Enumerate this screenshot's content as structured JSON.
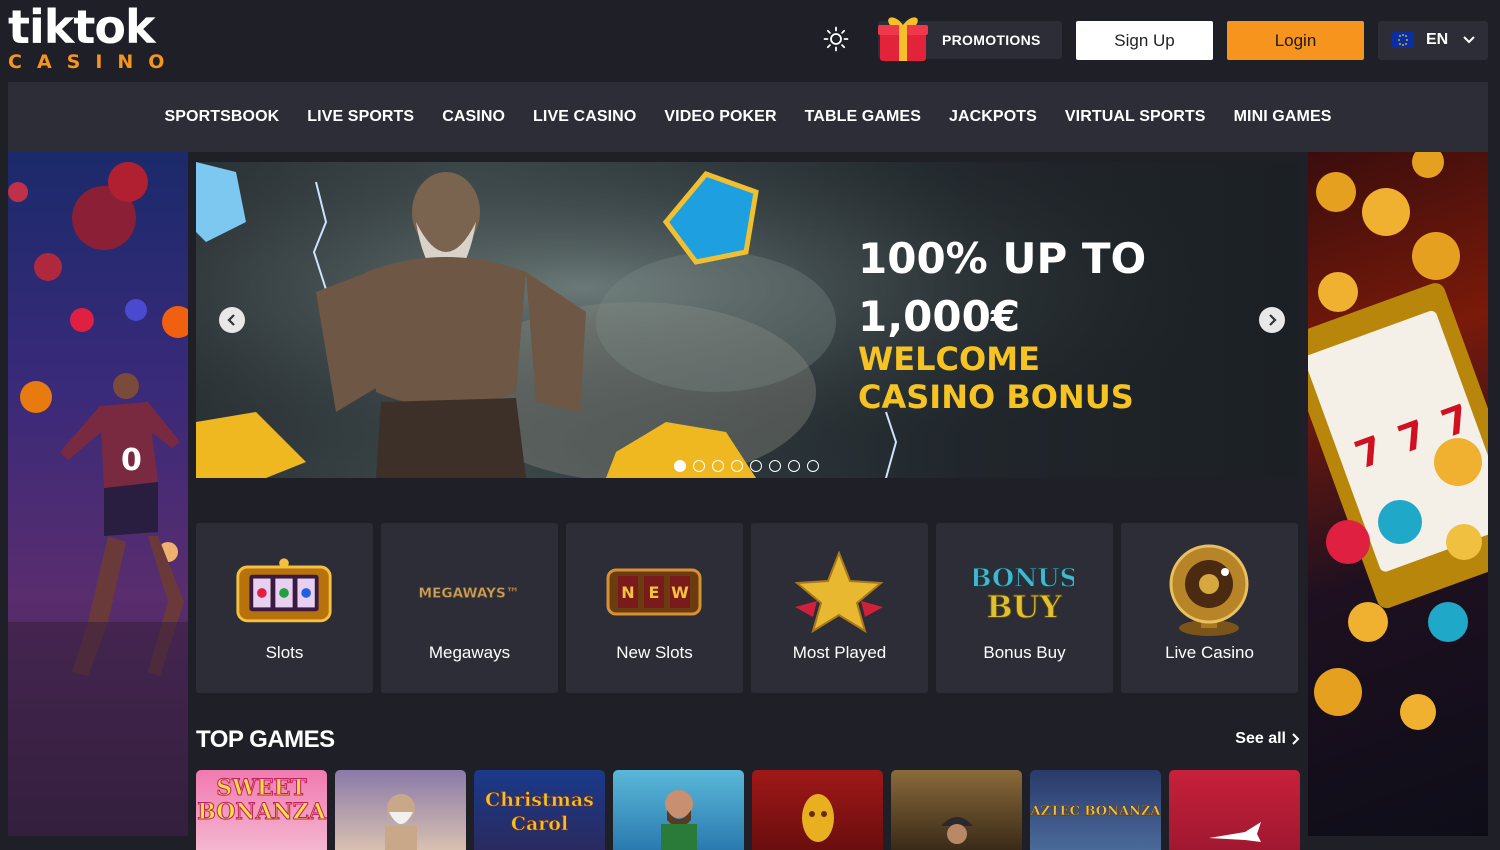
{
  "header": {
    "logo_word": "tiktok",
    "logo_sub": "CASINO",
    "promotions_label": "PROMOTIONS",
    "signup_label": "Sign Up",
    "login_label": "Login",
    "language_code": "EN"
  },
  "nav": {
    "items": [
      "SPORTSBOOK",
      "LIVE SPORTS",
      "CASINO",
      "LIVE CASINO",
      "VIDEO POKER",
      "TABLE GAMES",
      "JACKPOTS",
      "VIRTUAL SPORTS",
      "MINI GAMES"
    ]
  },
  "hero": {
    "line1": "100% UP TO",
    "line2": "1,000€",
    "line3": "WELCOME CASINO BONUS",
    "active_slide": 1,
    "slide_count": 8
  },
  "categories": [
    {
      "label": "Slots",
      "icon": "slot-machine-icon"
    },
    {
      "label": "Megaways",
      "icon": "megaways-icon"
    },
    {
      "label": "New Slots",
      "icon": "new-reels-icon"
    },
    {
      "label": "Most Played",
      "icon": "star-icon"
    },
    {
      "label": "Bonus Buy",
      "icon": "bonus-buy-icon"
    },
    {
      "label": "Live Casino",
      "icon": "roulette-icon"
    }
  ],
  "top_games": {
    "title": "TOP GAMES",
    "see_all_label": "See all",
    "games": [
      {
        "title": "SWEET BONANZA"
      },
      {
        "title": ""
      },
      {
        "title": "Christmas Carol"
      },
      {
        "title": ""
      },
      {
        "title": ""
      },
      {
        "title": ""
      },
      {
        "title": "AZTEC BONANZA"
      },
      {
        "title": ""
      }
    ]
  },
  "colors": {
    "accent": "#f7941d",
    "background": "#1f1f27",
    "panel": "#2c2d37",
    "bonus_yellow": "#f5c322"
  }
}
